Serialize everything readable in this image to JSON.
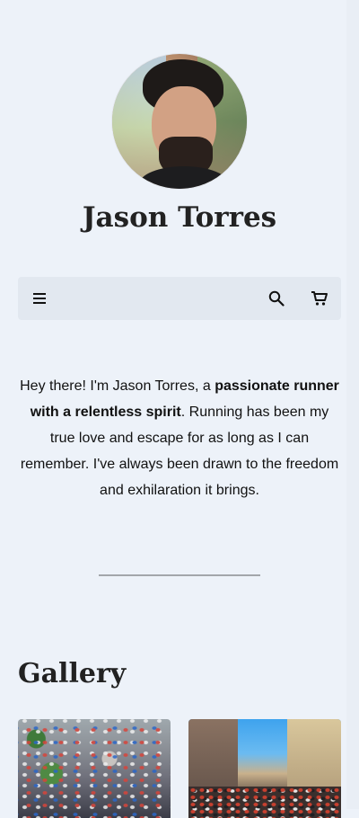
{
  "profile": {
    "name": "Jason Torres",
    "avatar_icon": "profile-photo"
  },
  "navbar": {
    "menu_icon": "hamburger-menu-icon",
    "search_icon": "search-icon",
    "cart_icon": "cart-icon"
  },
  "intro": {
    "part1": "Hey there! I'm Jason Torres, a ",
    "bold": "passionate runner with a relentless spirit",
    "part2": ". Running has been my true love and escape for as long as I can remember. I've always been drawn to the freedom and exhilaration it brings."
  },
  "gallery": {
    "title": "Gallery",
    "images": [
      "marathon-crowd-street",
      "city-marathon-start"
    ]
  },
  "colors": {
    "background": "#edf2f9",
    "navbar": "#e2e8f0",
    "text": "#111111",
    "divider": "#a3a6ab"
  }
}
